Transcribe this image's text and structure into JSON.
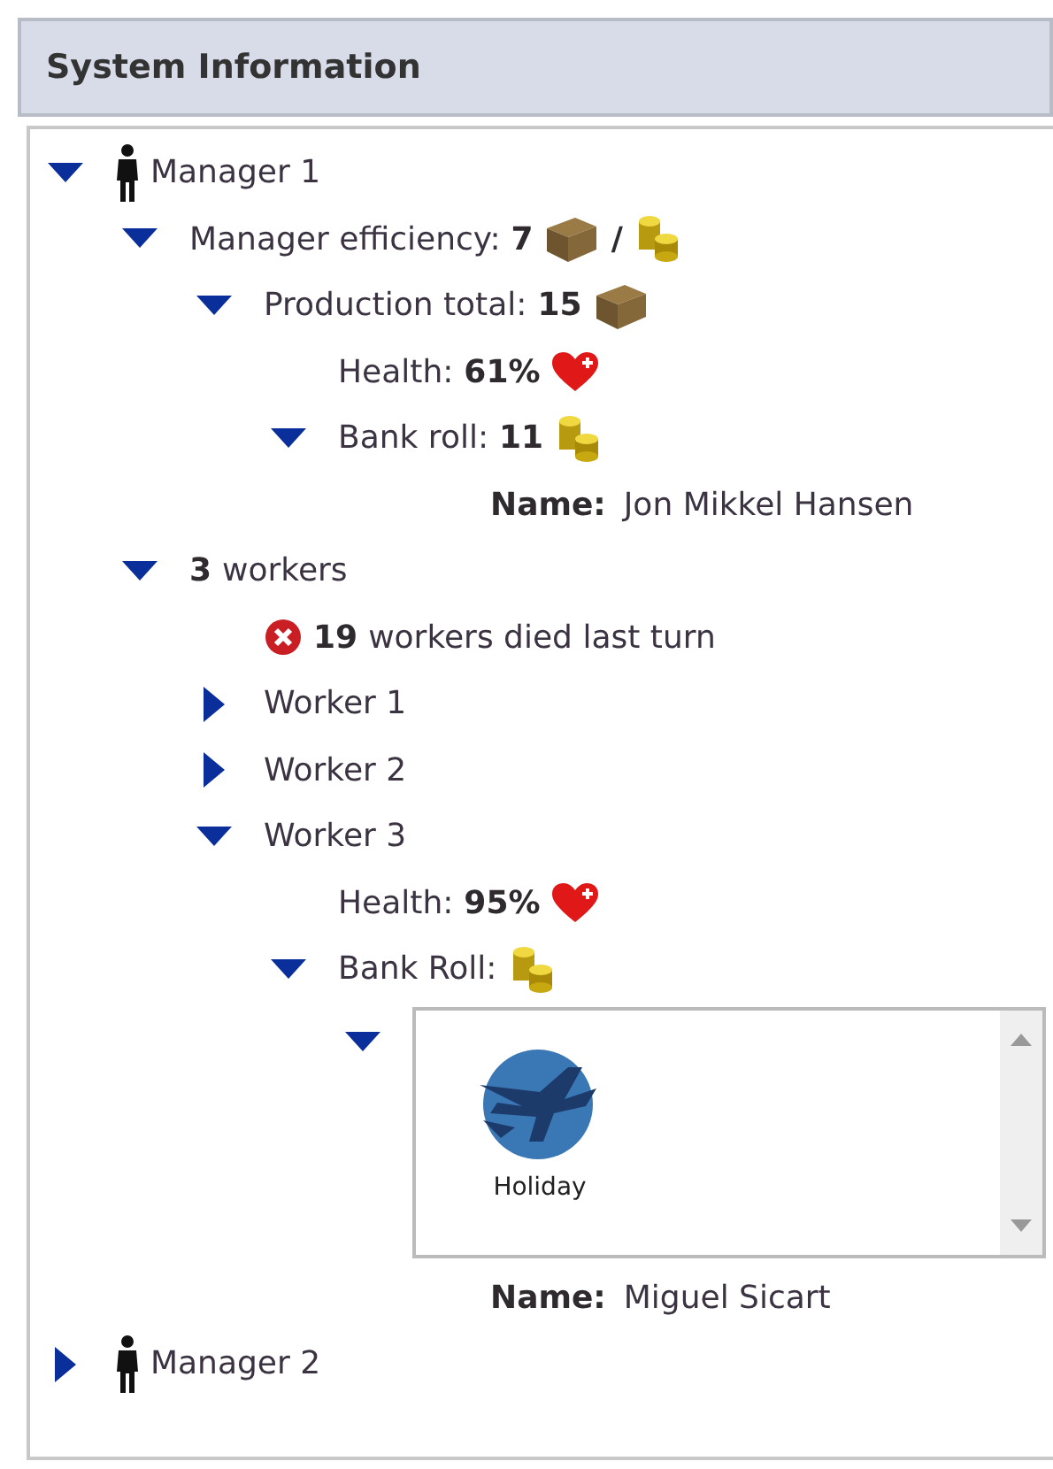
{
  "panel": {
    "title": "System Information"
  },
  "tree": [
    {
      "kind": "row",
      "expanded": true,
      "parts": [
        {
          "kind": "person"
        },
        {
          "kind": "text",
          "text": "Manager 1"
        }
      ],
      "children": [
        {
          "kind": "row",
          "expanded": true,
          "parts": [
            {
              "kind": "text",
              "text": "Manager efficiency:"
            },
            {
              "kind": "value",
              "text": "7"
            },
            {
              "kind": "box"
            },
            {
              "kind": "value",
              "text": "/"
            },
            {
              "kind": "coins"
            }
          ],
          "children": [
            {
              "kind": "row",
              "expanded": true,
              "parts": [
                {
                  "kind": "text",
                  "text": "Production total:"
                },
                {
                  "kind": "value",
                  "text": "15"
                },
                {
                  "kind": "box"
                }
              ],
              "children": [
                {
                  "kind": "row",
                  "parts": [
                    {
                      "kind": "text",
                      "text": "Health:"
                    },
                    {
                      "kind": "value",
                      "text": "61%"
                    },
                    {
                      "kind": "heart"
                    }
                  ]
                },
                {
                  "kind": "row",
                  "expanded": true,
                  "parts": [
                    {
                      "kind": "text",
                      "text": "Bank roll:"
                    },
                    {
                      "kind": "value",
                      "text": "11"
                    },
                    {
                      "kind": "coins"
                    }
                  ],
                  "children": [
                    {
                      "kind": "row",
                      "parts": [
                        {
                          "kind": "label",
                          "text": "Name:"
                        },
                        {
                          "kind": "text",
                          "text": "Jon Mikkel Hansen"
                        }
                      ]
                    }
                  ]
                }
              ]
            }
          ]
        },
        {
          "kind": "row",
          "expanded": true,
          "parts": [
            {
              "kind": "value",
              "text": "3"
            },
            {
              "kind": "text",
              "text": "workers"
            }
          ],
          "children": [
            {
              "kind": "row",
              "parts": [
                {
                  "kind": "error"
                },
                {
                  "kind": "value",
                  "text": "19"
                },
                {
                  "kind": "text",
                  "text": "workers died last turn"
                }
              ]
            },
            {
              "kind": "row",
              "expanded": false,
              "parts": [
                {
                  "kind": "text",
                  "text": "Worker 1"
                }
              ]
            },
            {
              "kind": "row",
              "expanded": false,
              "parts": [
                {
                  "kind": "text",
                  "text": "Worker 2"
                }
              ]
            },
            {
              "kind": "row",
              "expanded": true,
              "parts": [
                {
                  "kind": "text",
                  "text": "Worker 3"
                }
              ],
              "children": [
                {
                  "kind": "row",
                  "parts": [
                    {
                      "kind": "text",
                      "text": "Health:"
                    },
                    {
                      "kind": "value",
                      "text": "95%"
                    },
                    {
                      "kind": "heart"
                    }
                  ]
                },
                {
                  "kind": "row",
                  "expanded": true,
                  "parts": [
                    {
                      "kind": "text",
                      "text": "Bank Roll:"
                    },
                    {
                      "kind": "coins"
                    }
                  ],
                  "children": [
                    {
                      "kind": "gallery",
                      "expanded": true,
                      "items": [
                        {
                          "label": "Holiday"
                        }
                      ]
                    },
                    {
                      "kind": "row",
                      "parts": [
                        {
                          "kind": "label",
                          "text": "Name:"
                        },
                        {
                          "kind": "text",
                          "text": "Miguel Sicart"
                        }
                      ]
                    }
                  ]
                }
              ]
            }
          ]
        }
      ]
    },
    {
      "kind": "row",
      "expanded": false,
      "parts": [
        {
          "kind": "person"
        },
        {
          "kind": "text",
          "text": "Manager 2"
        }
      ]
    }
  ]
}
